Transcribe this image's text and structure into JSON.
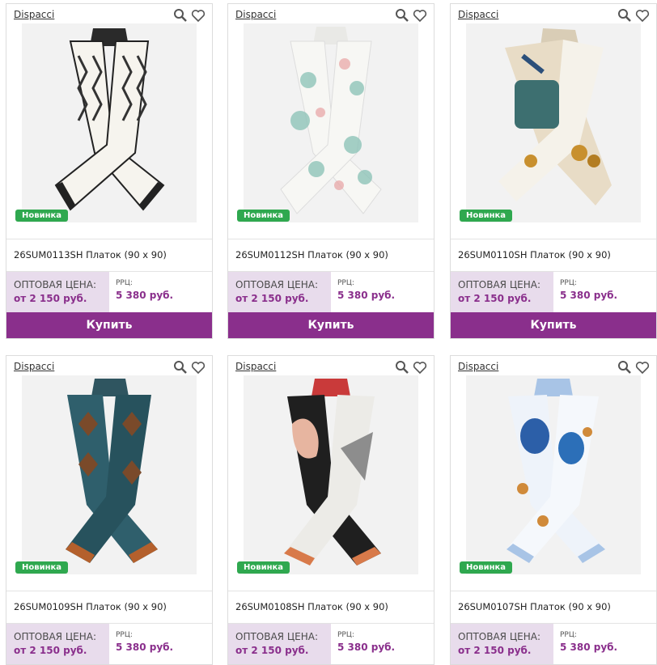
{
  "common": {
    "brand": "Dispacci",
    "badge": "Новинка",
    "wholesale_label": "ОПТОВАЯ ЦЕНА:",
    "wholesale_price": "от 2 150 руб.",
    "rrp_label": "РРЦ:",
    "rrp_price": "5 380 руб.",
    "buy_label": "Купить"
  },
  "products": [
    {
      "title": "26SUM0113SH Платок (90 х 90)"
    },
    {
      "title": "26SUM0112SH Платок (90 х 90)"
    },
    {
      "title": "26SUM0110SH Платок (90 х 90)"
    },
    {
      "title": "26SUM0109SH Платок (90 х 90)"
    },
    {
      "title": "26SUM0108SH Платок (90 х 90)"
    },
    {
      "title": "26SUM0107SH Платок (90 х 90)"
    }
  ],
  "colors": {
    "accent": "#8a2f8c",
    "badge": "#2fa84f",
    "price_bg": "#e8dcec"
  }
}
